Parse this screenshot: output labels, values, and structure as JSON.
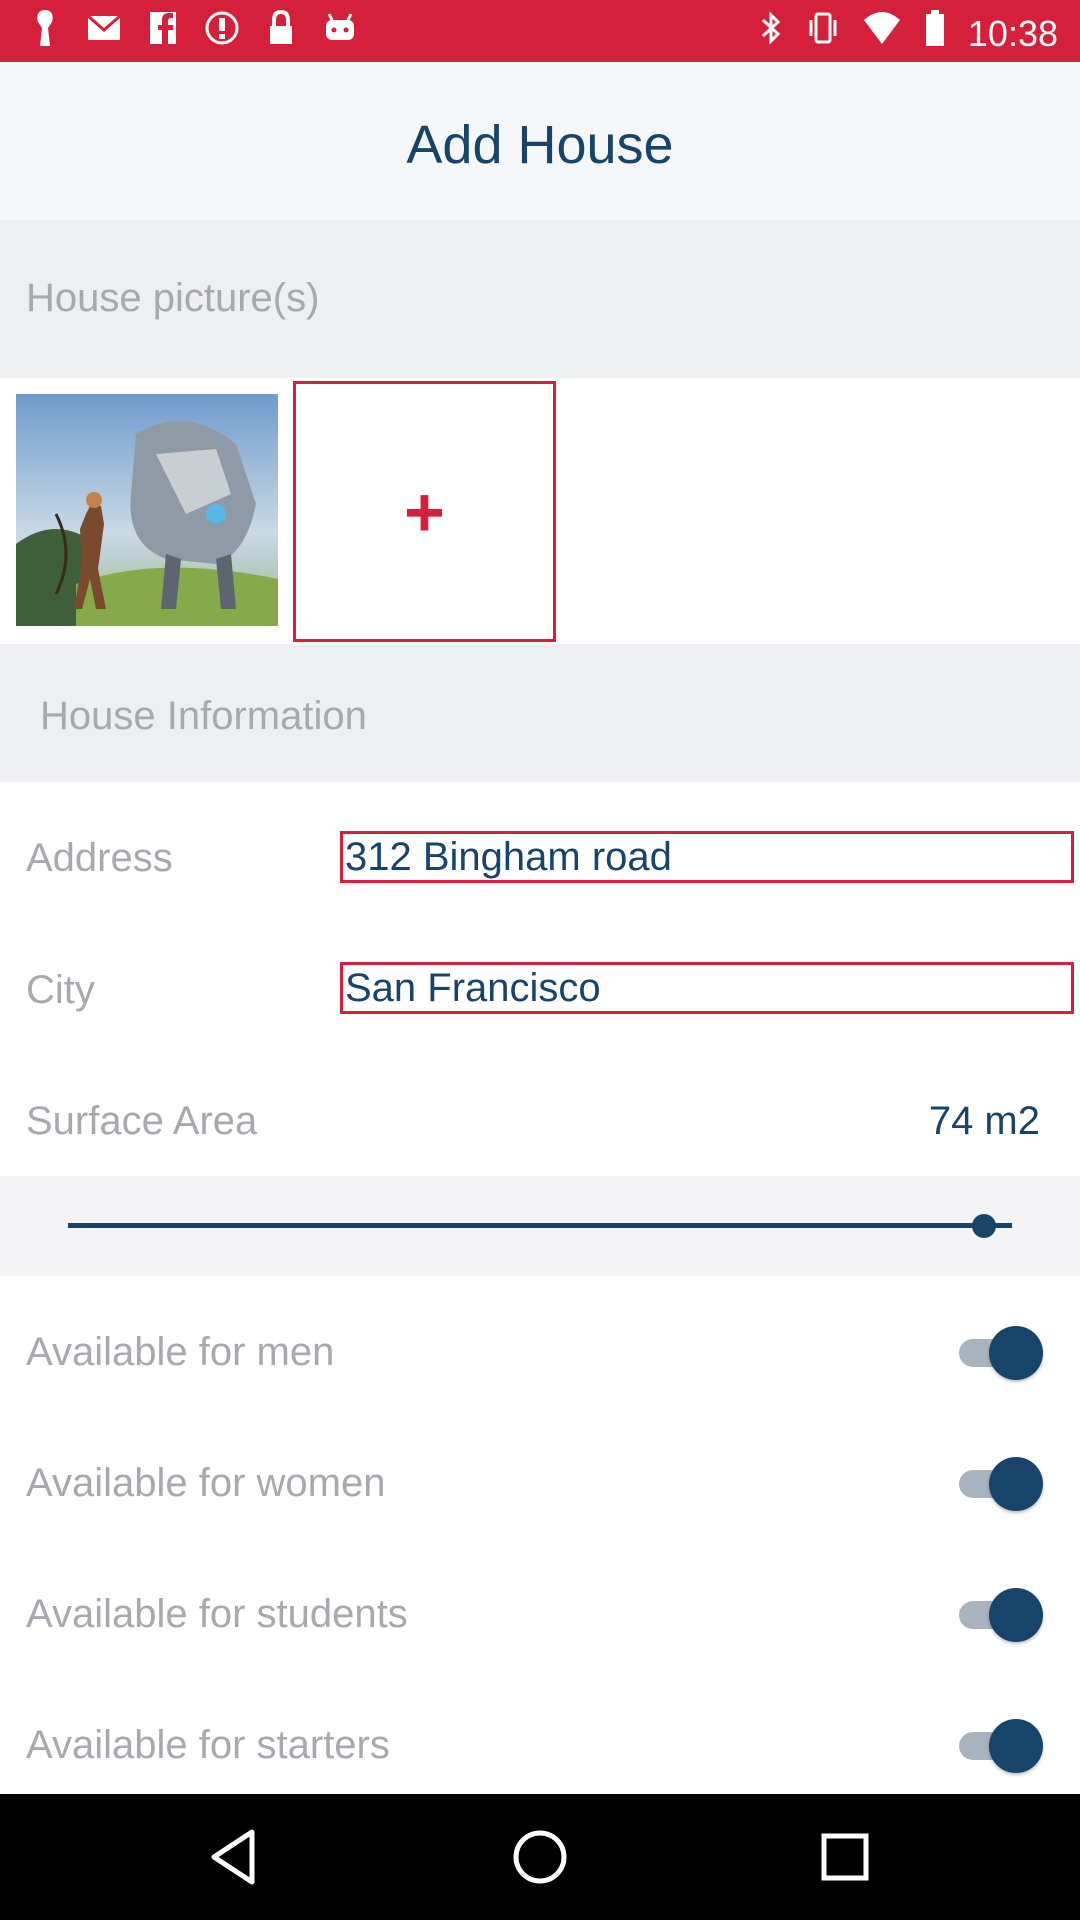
{
  "status_bar": {
    "time": "10:38",
    "icons_left": [
      "notification-icon",
      "mail-icon",
      "facebook-icon",
      "alert-icon",
      "lock-icon",
      "android-icon"
    ],
    "icons_right": [
      "bluetooth-icon",
      "vibrate-icon",
      "wifi-icon",
      "battery-icon"
    ]
  },
  "header": {
    "title": "Add House"
  },
  "pictures_section": {
    "title": "House picture(s)",
    "add_label": "+"
  },
  "info_section": {
    "title": "House Information",
    "address": {
      "label": "Address",
      "value": "312 Bingham road"
    },
    "city": {
      "label": "City",
      "value": "San Francisco"
    },
    "surface": {
      "label": "Surface Area",
      "value": "74 m2",
      "slider_fraction": 0.97
    }
  },
  "toggles": [
    {
      "label": "Available for men",
      "on": true
    },
    {
      "label": "Available for women",
      "on": true
    },
    {
      "label": "Available for students",
      "on": true
    },
    {
      "label": "Available for starters",
      "on": true
    }
  ],
  "colors": {
    "accent": "#d5203b",
    "primary": "#17446b",
    "label_gray": "#a6a9ae"
  },
  "nav": [
    "back-icon",
    "home-icon",
    "recents-icon"
  ]
}
